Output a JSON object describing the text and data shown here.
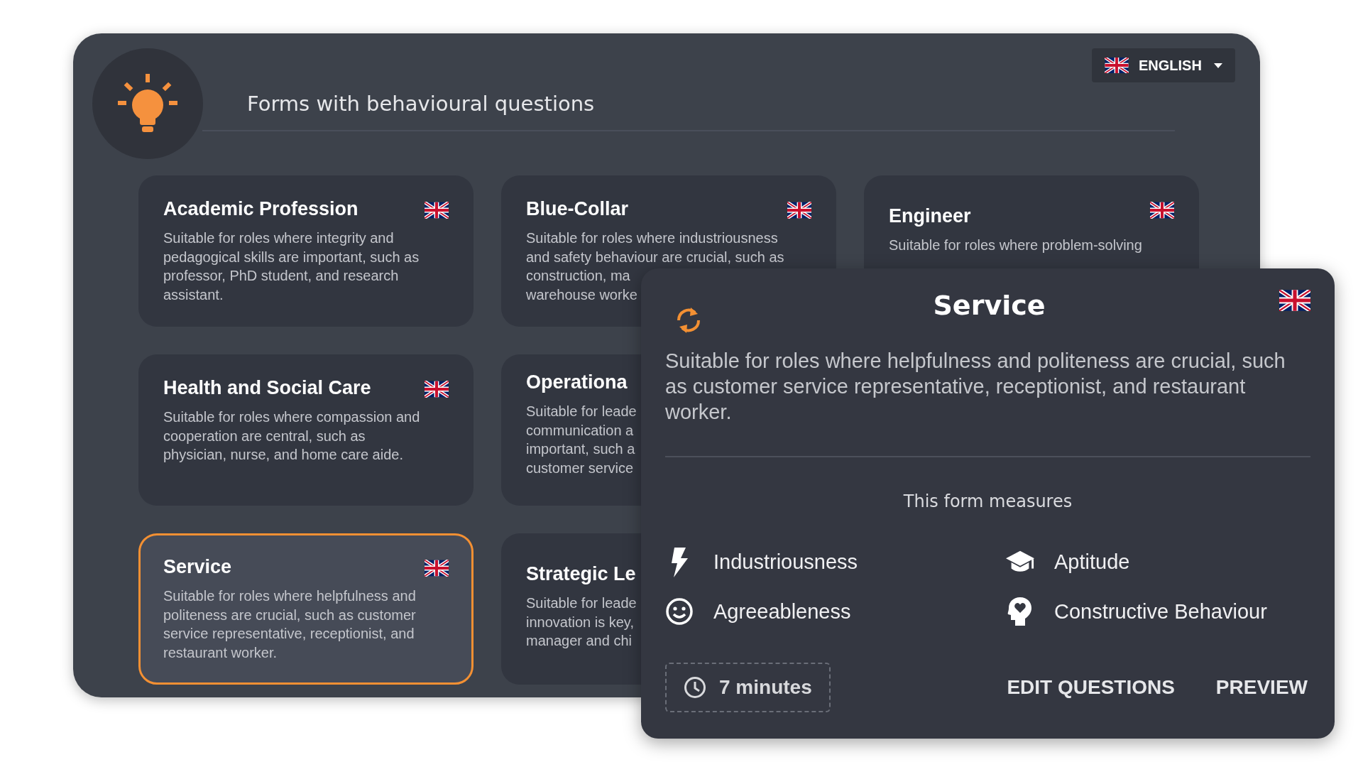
{
  "header": {
    "title": "Forms with behavioural questions"
  },
  "language": {
    "label": "ENGLISH"
  },
  "forms": [
    {
      "title": "Academic Profession",
      "description": "Suitable for roles where integrity and\npedagogical skills are important, such as\nprofessor, PhD student, and research\nassistant.",
      "selected": false
    },
    {
      "title": "Blue-Collar",
      "description": "Suitable for roles where industriousness\nand safety behaviour are crucial, such as\nconstruction, ma\nwarehouse worke",
      "selected": false
    },
    {
      "title": "Engineer",
      "description": "Suitable for roles where problem-solving",
      "selected": false
    },
    {
      "title": "Health and Social Care",
      "description": "Suitable for roles where compassion and\ncooperation are central, such as\nphysician, nurse, and home care aide.",
      "selected": false
    },
    {
      "title": "Operationa",
      "description": "Suitable for leade\ncommunication a\nimportant, such a\ncustomer service",
      "selected": false
    },
    {
      "title": "Service",
      "description": "Suitable for roles where helpfulness and\npoliteness are crucial, such as customer\nservice representative, receptionist, and\nrestaurant worker.",
      "selected": true
    },
    {
      "title": "Strategic Le",
      "description": "Suitable for leade\ninnovation is key,\nmanager and chi",
      "selected": false
    }
  ],
  "detail": {
    "title": "Service",
    "description": "Suitable for roles where helpfulness and politeness are crucial, such as customer service representative, receptionist, and restaurant worker.",
    "measures_heading": "This form measures",
    "measures": [
      {
        "label": "Industriousness"
      },
      {
        "label": "Aptitude"
      },
      {
        "label": "Agreeableness"
      },
      {
        "label": "Constructive Behaviour"
      }
    ],
    "duration": "7 minutes",
    "buttons": [
      {
        "label": "EDIT QUESTIONS"
      },
      {
        "label": "PREVIEW"
      }
    ]
  }
}
